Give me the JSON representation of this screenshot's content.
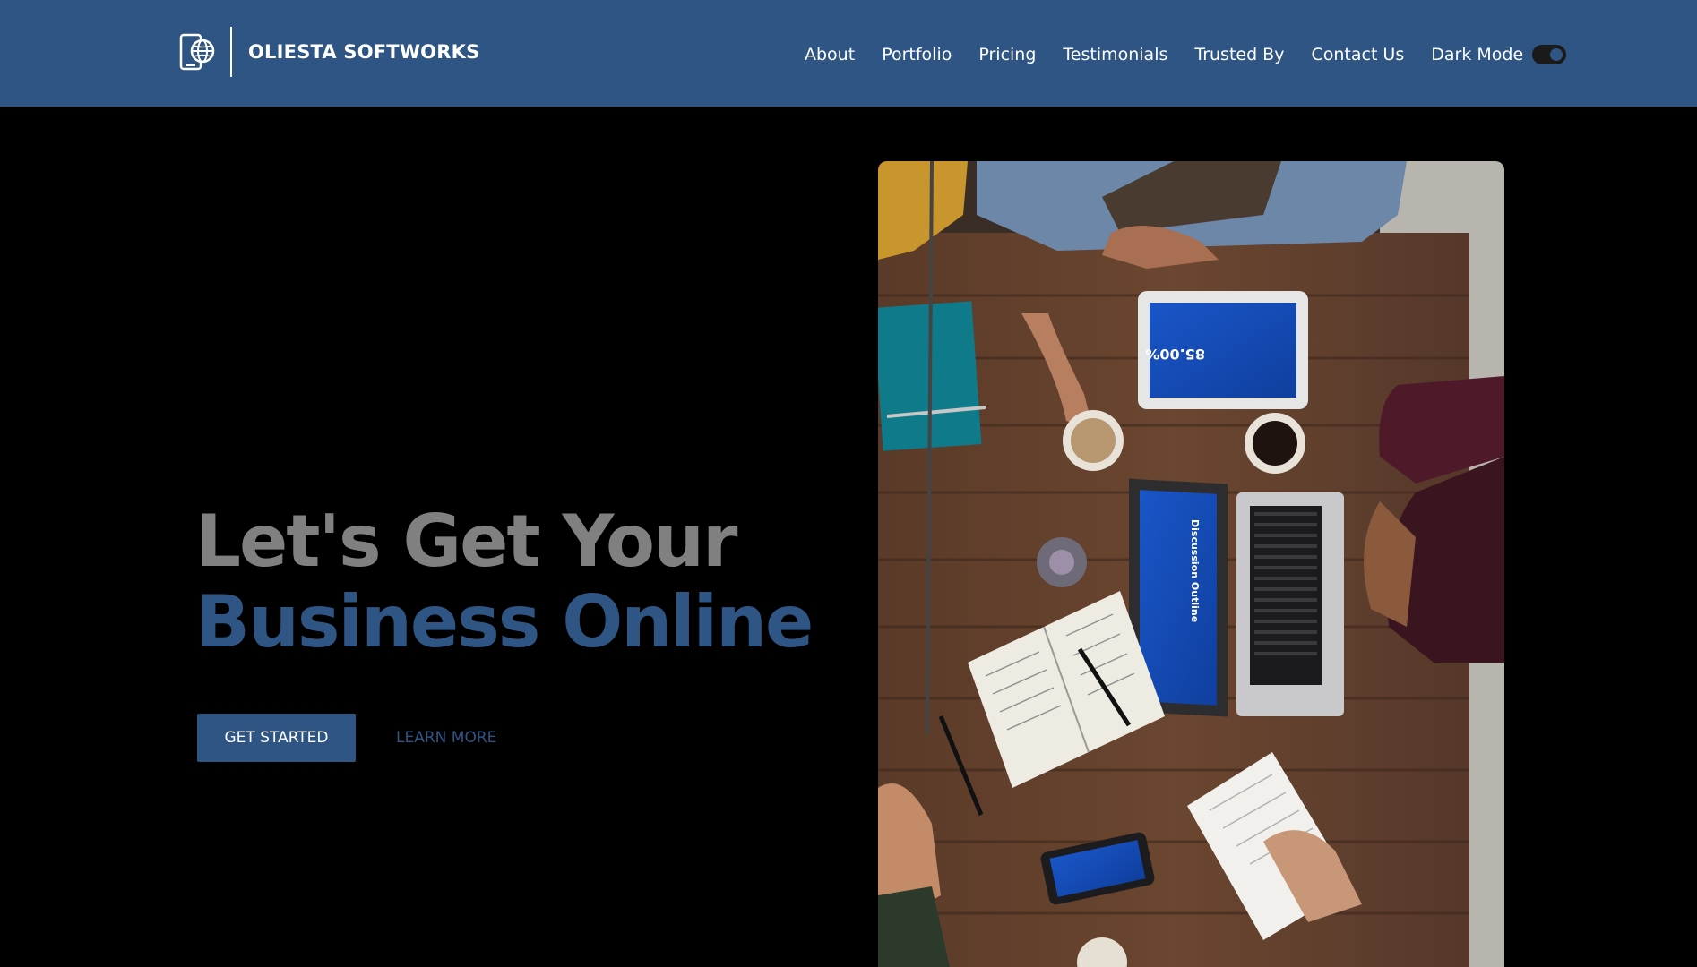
{
  "header": {
    "brand": "OLIESTA SOFTWORKS",
    "logo_icon": "globe-phone-icon",
    "nav": [
      {
        "label": "About"
      },
      {
        "label": "Portfolio"
      },
      {
        "label": "Pricing"
      },
      {
        "label": "Testimonials"
      },
      {
        "label": "Trusted By"
      },
      {
        "label": "Contact Us"
      }
    ],
    "dark_mode_label": "Dark Mode",
    "dark_mode_on": true
  },
  "hero": {
    "title_line1": "Let's Get Your",
    "title_line2": "Business Online",
    "primary_button": "GET STARTED",
    "secondary_button": "LEARN MORE",
    "image_description_icon": "team-meeting-photo"
  },
  "photo_text": {
    "tablet_value": "85.00%",
    "laptop_title": "Discussion Outline"
  },
  "colors": {
    "header_bg": "#2e5584",
    "accent": "#2e5584",
    "title_gray": "#808080",
    "page_bg": "#000000"
  }
}
